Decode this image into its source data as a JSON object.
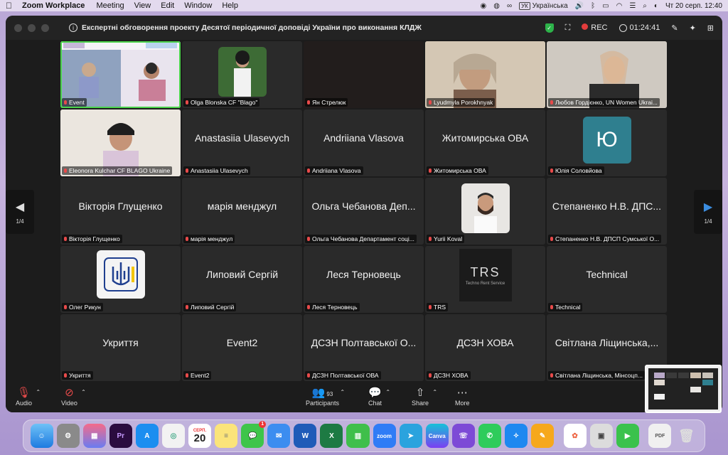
{
  "menubar": {
    "app_name": "Zoom Workplace",
    "menus": [
      "Meeting",
      "View",
      "Edit",
      "Window",
      "Help"
    ],
    "keyboard_layout": "Українська",
    "datetime": "Чт 20 серп.  12:40"
  },
  "window": {
    "title": "Експертні обговорення проекту Десятої періодичної доповіді України про виконання КЛДЖ",
    "rec_label": "REC",
    "timer": "01:24:41"
  },
  "gallery": {
    "page_indicator_left": "1/4",
    "page_indicator_right": "1/4",
    "tiles": [
      {
        "label": "Event",
        "big": ""
      },
      {
        "label": "Olga Blonska CF \"Blago\"",
        "big": ""
      },
      {
        "label": "Ян Стрелюк",
        "big": ""
      },
      {
        "label": "Lyudmyla Porokhnyak",
        "big": ""
      },
      {
        "label": "Любов Гордієнко, UN Women Ukrai...",
        "big": ""
      },
      {
        "label": "Eleonora Kulchar CF BLAGO Ukraine",
        "big": ""
      },
      {
        "label": "Anastasiia Ulasevych",
        "big": "Anastasiia Ulasevych"
      },
      {
        "label": "Andriiana Vlasova",
        "big": "Andriiana Vlasova"
      },
      {
        "label": "Житомирська ОВА",
        "big": "Житомирська ОВА"
      },
      {
        "label": "Юлія Соловйова",
        "big": "",
        "letter": "Ю"
      },
      {
        "label": "Вікторія Глущенко",
        "big": "Вікторія Глущенко"
      },
      {
        "label": "марія менджул",
        "big": "марія менджул"
      },
      {
        "label": "Ольга Чебанова Департамент соці...",
        "big": "Ольга Чебанова Деп..."
      },
      {
        "label": "Yurii Koval",
        "big": ""
      },
      {
        "label": "Степаненко Н.В. ДПСП Сумської О...",
        "big": "Степаненко Н.В. ДПС..."
      },
      {
        "label": "Олег Рикун",
        "big": ""
      },
      {
        "label": "Липовий Сергій",
        "big": "Липовий Сергій"
      },
      {
        "label": "Леся Терновець",
        "big": "Леся Терновець"
      },
      {
        "label": "TRS",
        "big": "",
        "logo_main": "TRS",
        "logo_sub": "Techno Rent Service"
      },
      {
        "label": "Technical",
        "big": "Technical"
      },
      {
        "label": "Укриття",
        "big": "Укриття"
      },
      {
        "label": "Event2",
        "big": "Event2"
      },
      {
        "label": "ДСЗН Полтавської ОВА",
        "big": "ДСЗН Полтавської О..."
      },
      {
        "label": "ДСЗН ХОВА",
        "big": "ДСЗН ХОВА"
      },
      {
        "label": "Світлана Ліщинська, Мінсоцп...",
        "big": "Світлана Ліщинська,..."
      }
    ]
  },
  "toolbar": {
    "audio": "Audio",
    "video": "Video",
    "participants": "Participants",
    "participants_count": "93",
    "chat": "Chat",
    "share": "Share",
    "more": "More"
  },
  "dock": {
    "calendar_month": "СЕРП.",
    "calendar_day": "20",
    "messages_badge": "1"
  },
  "colors": {
    "active_speaker": "#4bd34b",
    "rec": "#e23c3c",
    "muted": "#e84a4a"
  }
}
